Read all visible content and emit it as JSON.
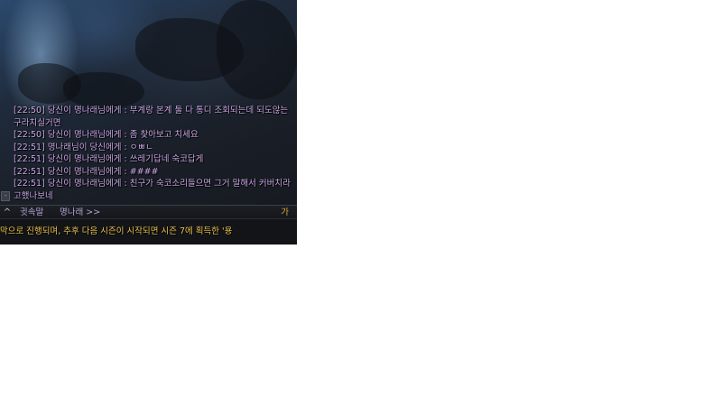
{
  "chat": {
    "lines": [
      "[22:50] 당신이 명나래님에게 : 부계랑 본계 둘 다 통디 조회되는데 되도않는",
      "구라치실거면",
      "[22:50] 당신이 명나래님에게 : 좀 찾아보고 치세요",
      "[22:51] 명나래님이 당신에게 : ㅇㅃㄴ",
      "[22:51] 당신이 명나래님에게 : 쓰레기답네 숙코답게",
      "[22:51] 당신이 명나래님에게 : ####",
      "[22:51] 당신이 명나래님에게 : 친구가 숙코소리들으면 그거 말해서 커버치라",
      "고했나보네"
    ]
  },
  "input_bar": {
    "expand_glyph": "^",
    "channel_label": "귓속말",
    "target_label": "명나래 >>",
    "ime_label": "가"
  },
  "notice": {
    "text": "막으로 진행되며, 추후 다음 시즌이 시작되면 시즌 7에 획득한 '용"
  },
  "colors": {
    "whisper_text": "#c9a7e6",
    "notice_text": "#e8c14a",
    "ime_indicator": "#e0a53a"
  }
}
